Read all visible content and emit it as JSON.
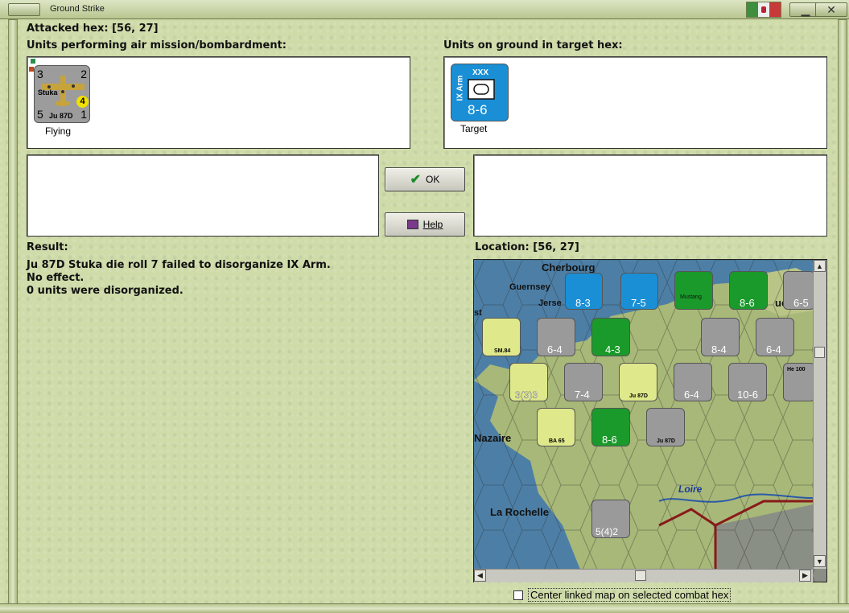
{
  "window": {
    "title": "Ground Strike"
  },
  "attacked_hex": "Attacked hex:  [56, 27]",
  "air_units_label": "Units performing air mission/bombardment:",
  "ground_units_label": "Units on ground in target hex:",
  "air_unit": {
    "name": "Stuka",
    "type": "Ju 87D",
    "top_left": "3",
    "top_right": "2",
    "bottom_left": "5",
    "bottom_right": "1",
    "badge": "4",
    "status": "Flying"
  },
  "ground_unit": {
    "designation": "IX Arm",
    "size": "XXX",
    "strength": "8-6",
    "status": "Target",
    "color": "#1a8fd6"
  },
  "buttons": {
    "ok": "OK",
    "help": "Help"
  },
  "result_label": "Result:",
  "result_lines": [
    "Ju 87D Stuka die roll 7 failed to disorganize IX Arm.",
    "No effect.",
    "0 units were disorganized."
  ],
  "location_label": "Location:  [56, 27]",
  "map": {
    "places": [
      "Cherbourg",
      "Guernsey",
      "Jerse",
      "st",
      "Nazaire",
      "La Rochelle",
      "Loire",
      "ue"
    ],
    "counters": [
      {
        "name": "counter-8-3",
        "text": "8-3",
        "size": "XXX",
        "color": "#1a8fd6"
      },
      {
        "name": "counter-7-5",
        "text": "7-5",
        "size": "XXX",
        "color": "#1a8fd6"
      },
      {
        "name": "counter-mustang",
        "text": "Mustang",
        "size": "P-51B",
        "color": "#1a9a2a"
      },
      {
        "name": "counter-8-6-top",
        "text": "8-6",
        "size": "XXX",
        "color": "#1a9a2a"
      },
      {
        "name": "counter-6-5",
        "text": "6-5",
        "size": "XXX",
        "color": "#9a9a9a"
      },
      {
        "name": "counter-sm84",
        "text": "SM.84",
        "size": "",
        "color": "#dfe88a"
      },
      {
        "name": "counter-6-4-a",
        "text": "6-4",
        "size": "XXX",
        "color": "#9a9a9a"
      },
      {
        "name": "counter-4-3",
        "text": "4-3",
        "size": "XX",
        "color": "#1a9a2a"
      },
      {
        "name": "counter-8-4",
        "text": "8-4",
        "size": "XXX",
        "color": "#9a9a9a"
      },
      {
        "name": "counter-6-4-b",
        "text": "6-4",
        "size": "XXX",
        "color": "#9a9a9a"
      },
      {
        "name": "counter-333",
        "text": "3(3)3",
        "size": "XXXXX",
        "color": "#dfe88a"
      },
      {
        "name": "counter-7-4",
        "text": "7-4",
        "size": "XXX",
        "color": "#9a9a9a"
      },
      {
        "name": "counter-stuka-map",
        "text": "Ju 87D",
        "size": "",
        "color": "#dfe88a"
      },
      {
        "name": "counter-6-4-c",
        "text": "6-4",
        "size": "XXX",
        "color": "#9a9a9a"
      },
      {
        "name": "counter-10-6",
        "text": "10-6",
        "size": "XXX",
        "color": "#9a9a9a"
      },
      {
        "name": "counter-he100",
        "text": "He 100",
        "size": "",
        "color": "#9a9a9a"
      },
      {
        "name": "counter-ba65",
        "text": "BA 65",
        "size": "",
        "color": "#dfe88a"
      },
      {
        "name": "counter-8-6-mid",
        "text": "8-6",
        "size": "XXX",
        "color": "#1a9a2a"
      },
      {
        "name": "counter-stuka-2",
        "text": "Ju 87D",
        "size": "",
        "color": "#9a9a9a"
      },
      {
        "name": "counter-542",
        "text": "5(4)2",
        "size": "XXXXX",
        "color": "#9a9a9a"
      }
    ]
  },
  "checkbox": {
    "label": "Center linked map on selected combat hex",
    "checked": false
  }
}
